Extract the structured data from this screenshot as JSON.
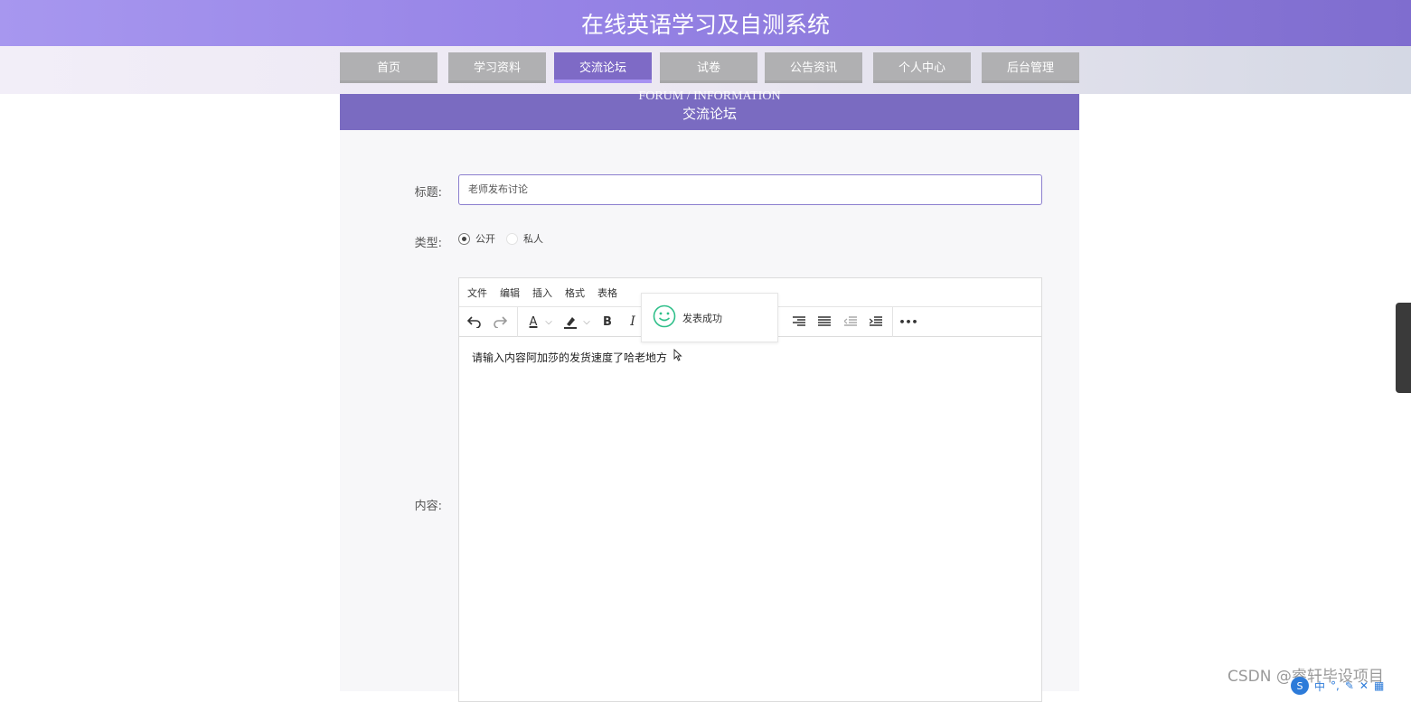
{
  "site": {
    "title": "在线英语学习及自测系统"
  },
  "nav": {
    "items": [
      {
        "label": "首页"
      },
      {
        "label": "学习资料"
      },
      {
        "label": "交流论坛",
        "active": true
      },
      {
        "label": "试卷"
      },
      {
        "label": "公告资讯"
      },
      {
        "label": "个人中心"
      },
      {
        "label": "后台管理"
      }
    ]
  },
  "banner": {
    "en": "FORUM / INFORMATION",
    "cn": "交流论坛"
  },
  "form": {
    "title_label": "标题:",
    "title_value": "老师发布讨论",
    "type_label": "类型:",
    "type_options": [
      {
        "label": "公开",
        "checked": true
      },
      {
        "label": "私人",
        "checked": false
      }
    ],
    "content_label": "内容:"
  },
  "editor": {
    "menu": [
      "文件",
      "编辑",
      "插入",
      "格式",
      "表格"
    ],
    "toolbar": {
      "undo": "undo-icon",
      "redo": "redo-icon",
      "font_color": "A",
      "bold": "B",
      "italic": "I",
      "more": "•••"
    },
    "content": "请输入内容阿加莎的发货速度了哈老地方"
  },
  "toast": {
    "text": "发表成功",
    "icon": "smile-icon"
  },
  "watermark": "CSDN @睿轩毕设项目",
  "ime": {
    "lang": "中"
  },
  "colors": {
    "header": "#9683e6",
    "nav_active": "#7e6ac6",
    "banner": "#7a6bc1",
    "toast_icon": "#2fbf8a"
  }
}
